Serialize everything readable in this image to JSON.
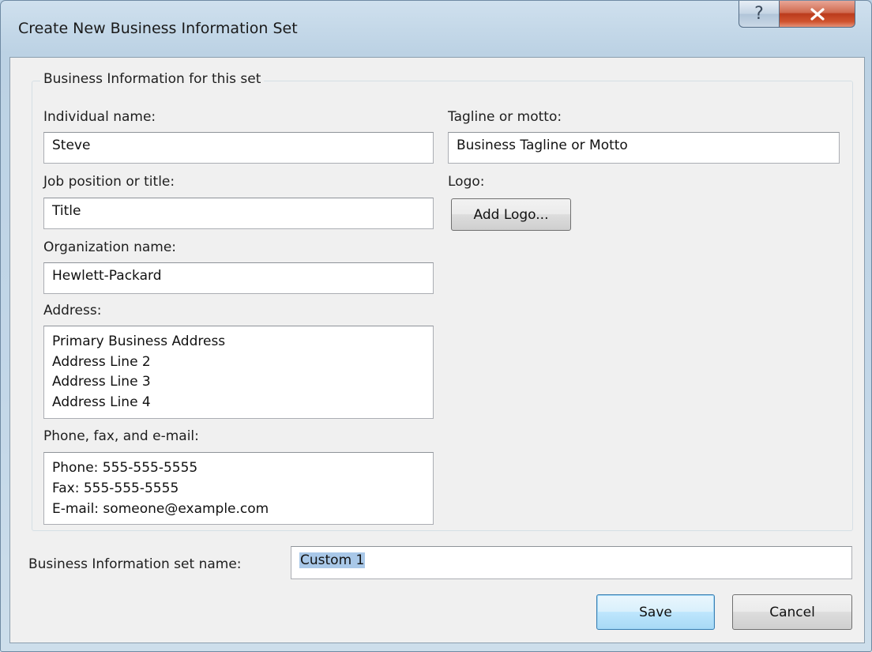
{
  "window": {
    "title": "Create New Business Information Set",
    "help_glyph": "?",
    "close_glyph": "X"
  },
  "group": {
    "legend": "Business Information for this set"
  },
  "fields": {
    "individual_name": {
      "label": "Individual name:",
      "value": "Steve"
    },
    "job_title": {
      "label": "Job position or title:",
      "value": "Title"
    },
    "organization": {
      "label": "Organization name:",
      "value": "Hewlett-Packard"
    },
    "address": {
      "label": "Address:",
      "lines": [
        "Primary Business Address",
        "Address Line 2",
        "Address Line 3",
        "Address Line 4"
      ]
    },
    "contact": {
      "label": "Phone, fax, and e-mail:",
      "lines": [
        "Phone: 555-555-5555",
        "Fax: 555-555-5555",
        "E-mail: someone@example.com"
      ]
    },
    "tagline": {
      "label": "Tagline or motto:",
      "value": "Business Tagline or Motto"
    },
    "logo": {
      "label": "Logo:",
      "button": "Add Logo..."
    }
  },
  "set_name": {
    "label": "Business Information set name:",
    "value": "Custom 1"
  },
  "buttons": {
    "save": "Save",
    "cancel": "Cancel"
  },
  "colors": {
    "selection": "#a9c8e8",
    "default_button_border": "#3c7fb1",
    "close_button": "#c9482a"
  }
}
